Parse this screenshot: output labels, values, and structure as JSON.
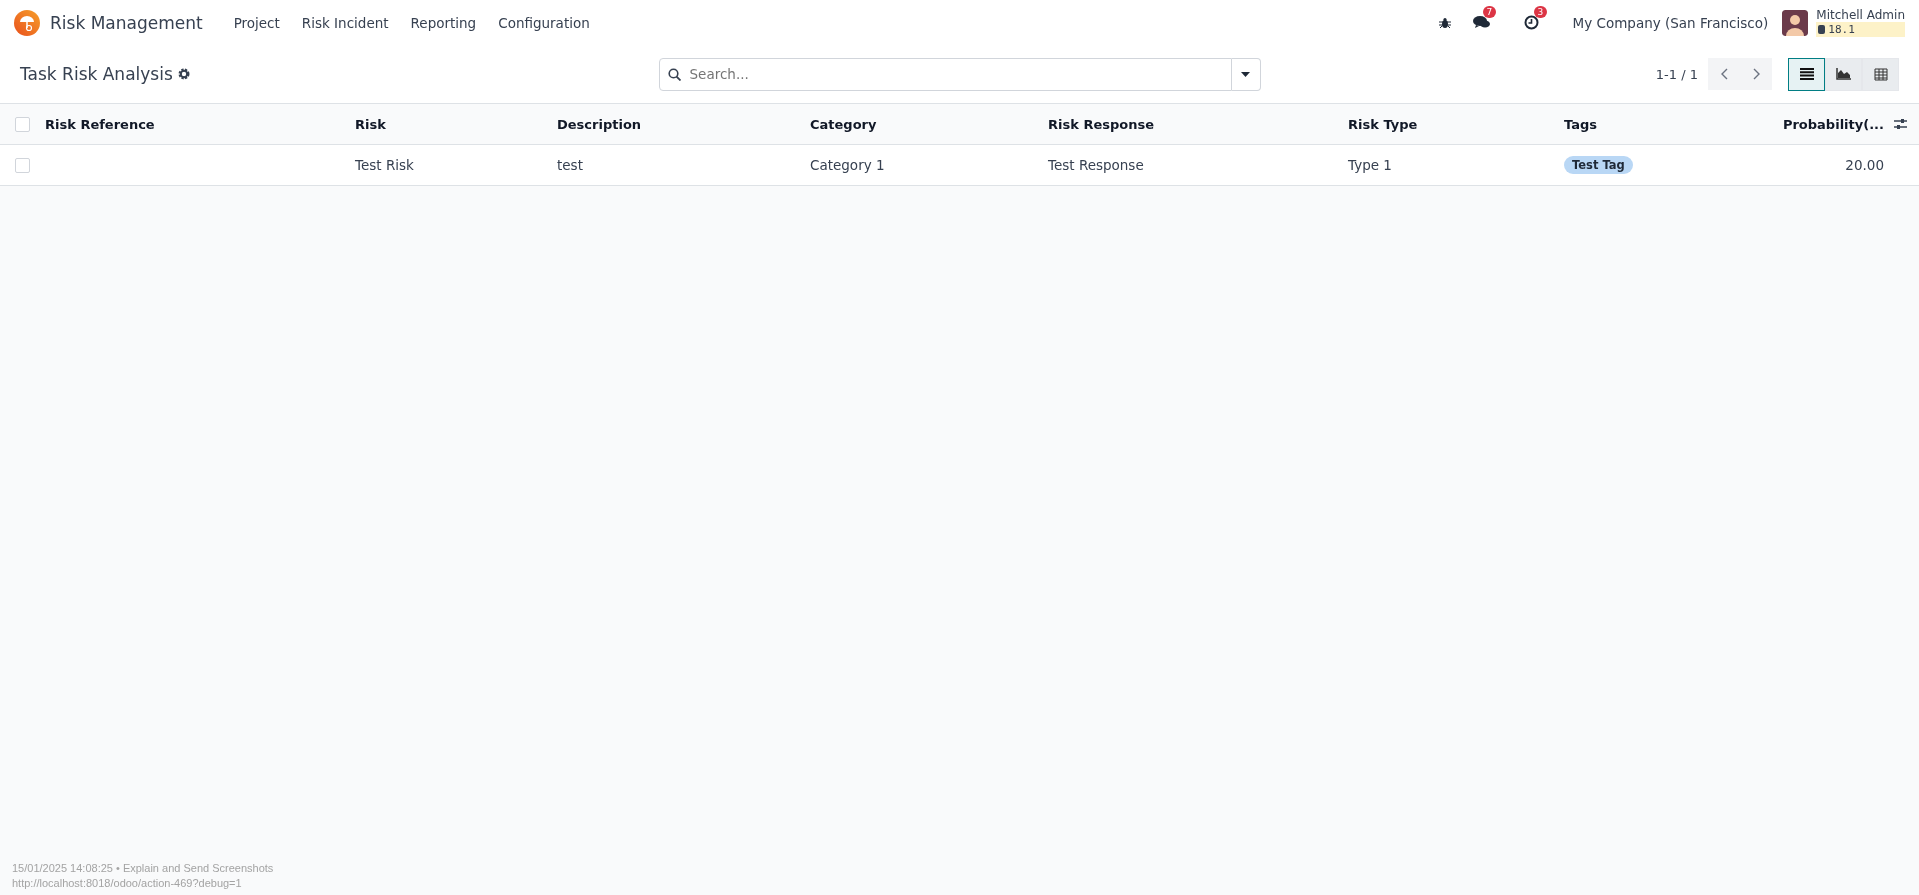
{
  "navbar": {
    "app_name": "Risk Management",
    "menu": [
      "Project",
      "Risk Incident",
      "Reporting",
      "Configuration"
    ],
    "messages_badge": "7",
    "activities_badge": "3",
    "company": "My Company (San Francisco)",
    "user": "Mitchell Admin",
    "version": "18.1"
  },
  "control_panel": {
    "title": "Task Risk Analysis",
    "search": {
      "placeholder": "Search..."
    },
    "pager": "1-1 / 1",
    "views": [
      {
        "kind": "list",
        "selected": true
      },
      {
        "kind": "graph",
        "selected": false
      },
      {
        "kind": "pivot",
        "selected": false
      }
    ]
  },
  "table": {
    "select_all_checked": false,
    "columns": [
      "Risk Reference",
      "Risk",
      "Description",
      "Category",
      "Risk Response",
      "Risk Type",
      "Tags",
      "Probability(..."
    ],
    "rows": [
      {
        "checked": false,
        "cells": [
          "",
          "Test Risk",
          "test",
          "Category 1",
          "Test Response",
          "Type 1",
          {
            "tags": [
              "Test Tag"
            ]
          },
          "20.00"
        ]
      }
    ]
  },
  "footer": {
    "caption": "15/01/2025 14:08:25 • Explain and Send Screenshots",
    "url": "http://localhost:8018/odoo/action-469?debug=1"
  }
}
